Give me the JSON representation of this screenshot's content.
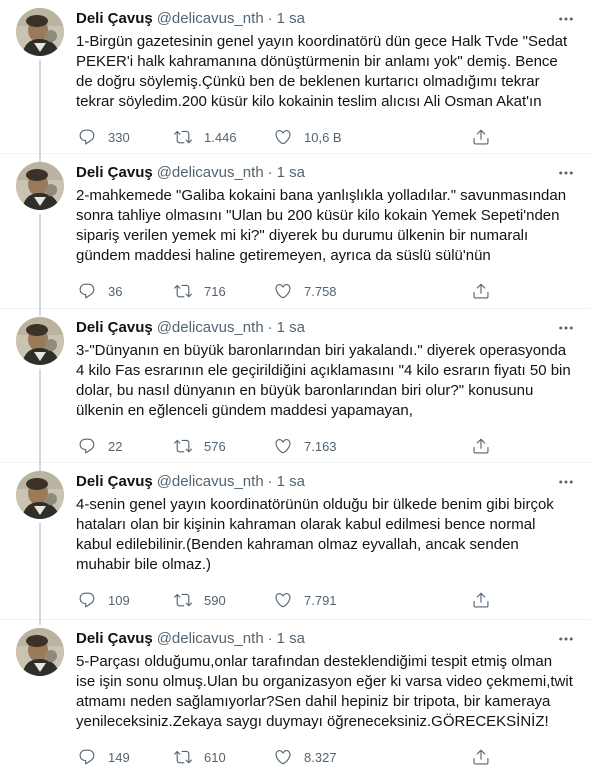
{
  "author": {
    "name": "Deli Çavuş",
    "handle": "@delicavus_nth",
    "dot": "·",
    "time": "1 sa"
  },
  "icons": {
    "reply": "reply-icon",
    "retweet": "retweet-icon",
    "like": "heart-icon",
    "share": "share-icon",
    "more": "more-icon"
  },
  "tweets": [
    {
      "text": "1-Birgün gazetesinin genel yayın koordinatörü dün gece Halk Tvde \"Sedat PEKER'i halk kahramanına dönüştürmenin bir anlamı yok\" demiş. Bence de doğru söylemiş.Çünkü ben de beklenen kurtarıcı olmadığımı tekrar tekrar söyledim.200 küsür kilo kokainin teslim alıcısı Ali Osman Akat'ın",
      "replies": "330",
      "retweets": "1.446",
      "likes": "10,6 B"
    },
    {
      "text": "2-mahkemede \"Galiba kokaini bana yanlışlıkla yolladılar.\" savunmasından sonra tahliye olmasını \"Ulan bu 200 küsür kilo kokain Yemek Sepeti'nden sipariş verilen yemek mi ki?\" diyerek bu durumu ülkenin bir numaralı gündem maddesi haline getiremeyen, ayrıca da süslü sülü'nün",
      "replies": "36",
      "retweets": "716",
      "likes": "7.758"
    },
    {
      "text": "3-\"Dünyanın en büyük baronlarından biri yakalandı.\" diyerek operasyonda 4 kilo Fas esrarının ele geçirildiğini açıklamasını \"4 kilo esrarın fiyatı 50 bin dolar, bu nasıl dünyanın en büyük baronlarından biri olur?\" konusunu ülkenin en eğlenceli gündem maddesi yapamayan,",
      "replies": "22",
      "retweets": "576",
      "likes": "7.163"
    },
    {
      "text": "4-senin genel yayın koordinatörünün olduğu bir ülkede benim gibi birçok hataları olan bir kişinin kahraman olarak kabul edilmesi bence normal kabul edilebilinir.(Benden kahraman olmaz eyvallah, ancak senden muhabir bile olmaz.)",
      "replies": "109",
      "retweets": "590",
      "likes": "7.791"
    },
    {
      "text": "5-Parçası olduğumu,onlar tarafından desteklendiğimi tespit etmiş olman ise işin sonu olmuş.Ulan bu organizasyon eğer ki varsa video çekmemi,twit atmamı neden sağlamıyorlar?Sen dahil hepiniz bir tripota, bir kameraya yenileceksiniz.Zekaya saygı duymayı öğreneceksiniz.GÖRECEKSİNİZ!",
      "replies": "149",
      "retweets": "610",
      "likes": "8.327"
    }
  ]
}
